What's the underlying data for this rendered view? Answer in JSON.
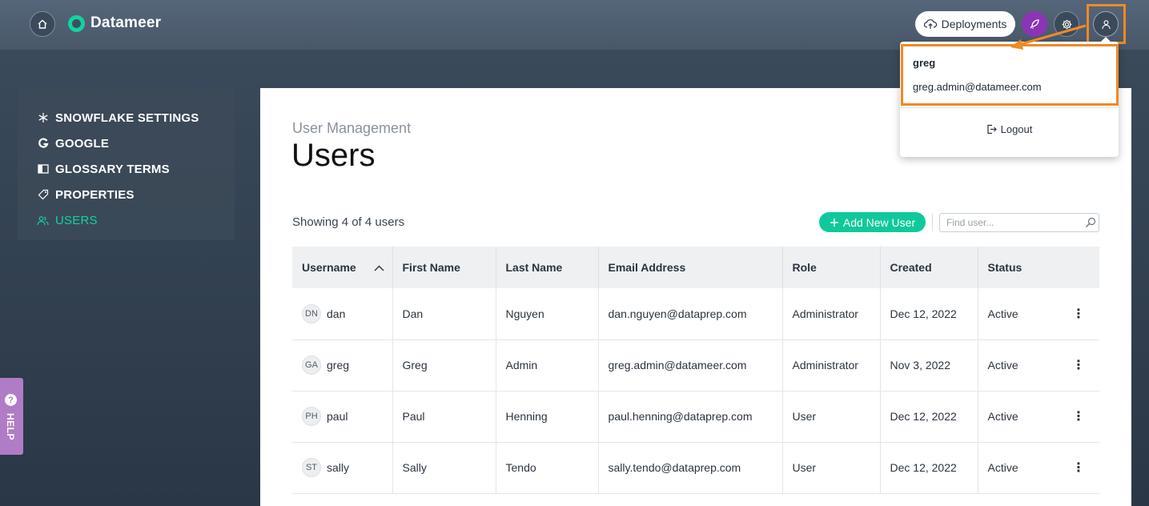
{
  "app": {
    "brand": "Datameer",
    "deployments_label": "Deployments"
  },
  "user_menu": {
    "username": "greg",
    "email": "greg.admin@datameer.com",
    "logout_label": "Logout"
  },
  "sidebar": {
    "items": [
      {
        "label": "SNOWFLAKE SETTINGS",
        "icon": "snowflake-icon",
        "active": false
      },
      {
        "label": "GOOGLE",
        "icon": "google-icon",
        "active": false
      },
      {
        "label": "GLOSSARY TERMS",
        "icon": "book-icon",
        "active": false
      },
      {
        "label": "PROPERTIES",
        "icon": "tag-icon",
        "active": false
      },
      {
        "label": "USERS",
        "icon": "users-icon",
        "active": true
      }
    ]
  },
  "page": {
    "breadcrumb": "User Management",
    "title": "Users",
    "count_text": "Showing 4 of 4 users",
    "add_button": "Add New User",
    "search_placeholder": "Find user..."
  },
  "table": {
    "columns": [
      "Username",
      "First Name",
      "Last Name",
      "Email Address",
      "Role",
      "Created",
      "Status"
    ],
    "rows": [
      {
        "initials": "DN",
        "username": "dan",
        "first": "Dan",
        "last": "Nguyen",
        "email": "dan.nguyen@dataprep.com",
        "role": "Administrator",
        "created": "Dec 12, 2022",
        "status": "Active"
      },
      {
        "initials": "GA",
        "username": "greg",
        "first": "Greg",
        "last": "Admin",
        "email": "greg.admin@datameer.com",
        "role": "Administrator",
        "created": "Nov 3, 2022",
        "status": "Active"
      },
      {
        "initials": "PH",
        "username": "paul",
        "first": "Paul",
        "last": "Henning",
        "email": "paul.henning@dataprep.com",
        "role": "User",
        "created": "Dec 12, 2022",
        "status": "Active"
      },
      {
        "initials": "ST",
        "username": "sally",
        "first": "Sally",
        "last": "Tendo",
        "email": "sally.tendo@dataprep.com",
        "role": "User",
        "created": "Dec 12, 2022",
        "status": "Active"
      }
    ]
  },
  "help": {
    "label": "HELP",
    "icon_glyph": "?"
  },
  "colors": {
    "accent": "#10c99a",
    "highlight": "#f08a24",
    "help": "#b07cc6",
    "rocket": "#8b35b5"
  }
}
